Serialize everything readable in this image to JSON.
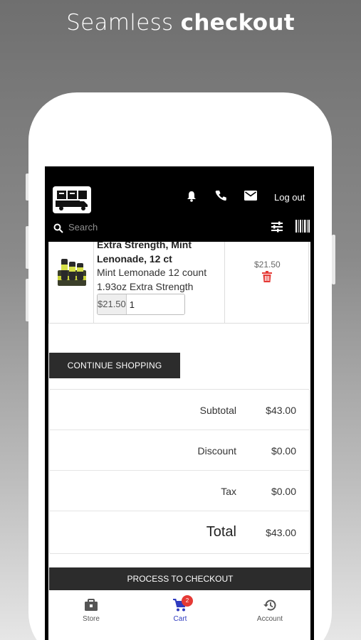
{
  "promo": {
    "title_light": "Seamless",
    "title_bold": "checkout"
  },
  "header": {
    "logout_label": "Log out",
    "search_placeholder": "Search",
    "icons": [
      "bell-icon",
      "phone-icon",
      "mail-icon",
      "filter-icon",
      "barcode-icon"
    ]
  },
  "cart_item": {
    "title_line1": "Extra Strength, Mint",
    "title_line2": "Lenonade, 12 ct",
    "desc_line1": "Mint Lemonade 12 count",
    "desc_line2": "1.93oz Extra Strength",
    "unit_price": "$21.50",
    "quantity": "1",
    "line_price": "$21.50"
  },
  "continue_label": "CONTINUE SHOPPING",
  "totals": [
    {
      "label": "Subtotal",
      "value": "$43.00"
    },
    {
      "label": "Discount",
      "value": "$0.00"
    },
    {
      "label": "Tax",
      "value": "$0.00"
    },
    {
      "label": "Total",
      "value": "$43.00"
    }
  ],
  "checkout_label": "PROCESS TO CHECKOUT",
  "tabs": [
    {
      "label": "Store",
      "icon": "store-icon"
    },
    {
      "label": "Cart",
      "icon": "cart-icon",
      "badge": "2",
      "active": true
    },
    {
      "label": "Account",
      "icon": "history-icon"
    }
  ],
  "colors": {
    "accent": "#2f3bbf",
    "badge": "#e53935",
    "delete": "#e53935",
    "button": "#2c2c2c"
  }
}
